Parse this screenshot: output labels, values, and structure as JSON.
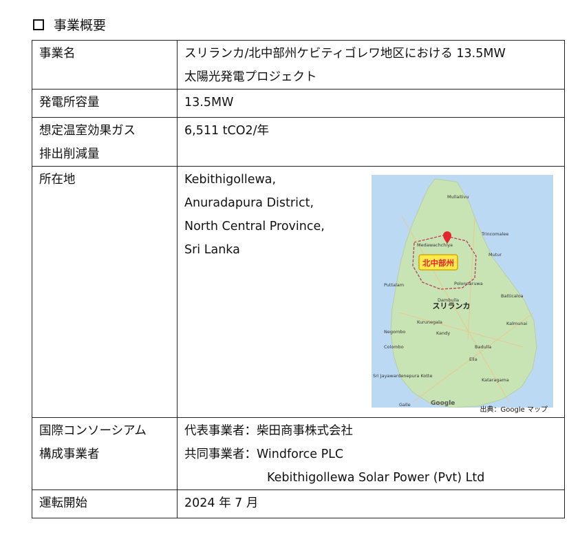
{
  "heading": "事業概要",
  "rows": {
    "name": {
      "label": "事業名",
      "value_line1": "スリランカ/北中部州ケビティゴレワ地区における 13.5MW",
      "value_line2": "太陽光発電プロジェクト"
    },
    "capacity": {
      "label": "発電所容量",
      "value": "13.5MW"
    },
    "reduction": {
      "label_line1": "想定温室効果ガス",
      "label_line2": "排出削減量",
      "value": "6,511 tCO2/年"
    },
    "location": {
      "label": "所在地",
      "lines": [
        "Kebithigollewa,",
        "Anuradapura District,",
        "North Central Province,",
        "Sri Lanka"
      ]
    },
    "consortium": {
      "label_line1": "国際コンソーシアム",
      "label_line2": "構成事業者",
      "lead_prefix": "代表事業者：",
      "lead_value": "柴田商事株式会社",
      "partner_prefix": "共同事業者：",
      "partner_value1": "Windforce PLC",
      "partner_value2": "Kebithigollewa Solar Power (Pvt) Ltd"
    },
    "start": {
      "label": "運転開始",
      "value": "2024 年 7 月"
    }
  },
  "map": {
    "province_label": "北中部州",
    "country_label": "スリランカ",
    "place_labels": [
      "Medawachchiya",
      "Trincomalee",
      "Mullaitivu",
      "Mutur",
      "Puttalam",
      "Polonnaruwa",
      "Dambulla",
      "Batticaloa",
      "Kurunegala",
      "Kandy",
      "Negombo",
      "Colombo",
      "Kalmunai",
      "Badulla",
      "Ella",
      "Sri Jayawardenepura Kotte",
      "Kataragama",
      "Galle"
    ],
    "brand_label": "Google",
    "credit": "出典：Google マップ",
    "colors": {
      "sea": "#bcd9f3",
      "land": "#c8e3b4",
      "highlight": "#ffe94d",
      "marker": "#e3262b"
    }
  }
}
